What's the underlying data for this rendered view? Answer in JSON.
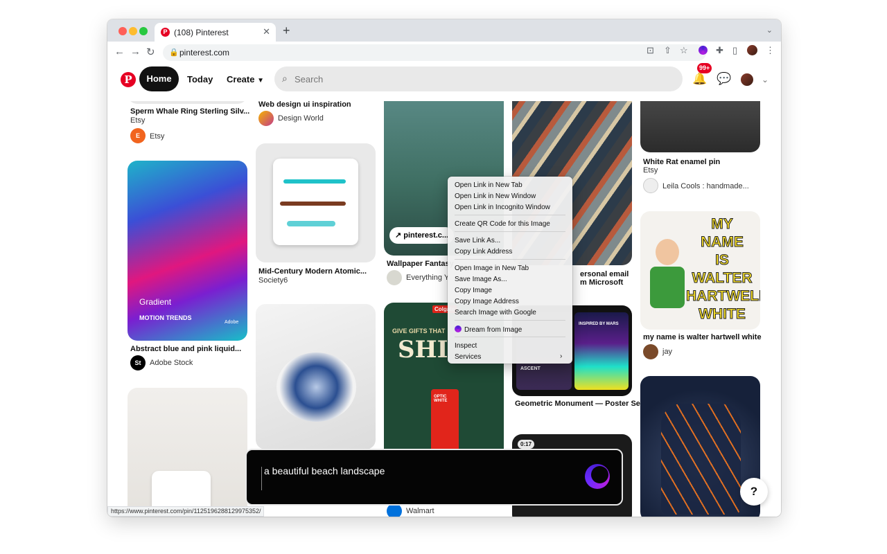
{
  "browser": {
    "tab_title": "(108) Pinterest",
    "tab_favicon": "pinterest-favicon",
    "url": "pinterest.com",
    "status_url": "https://www.pinterest.com/pin/1125196288129975352/"
  },
  "header": {
    "logo_letter": "P",
    "home_label": "Home",
    "today_label": "Today",
    "create_label": "Create",
    "search_placeholder": "Search",
    "notification_badge": "99+"
  },
  "pins": [
    {
      "title": "Sperm Whale Ring Sterling Silv...",
      "subtitle": "Etsy",
      "author": "Etsy",
      "author_initial": "E"
    },
    {
      "title": "Abstract blue and pink liquid...",
      "author": "Adobe Stock",
      "author_initial": "St",
      "image_text_1": "Gradient",
      "image_text_2": "MOTION TRENDS",
      "image_text_3": "Adobe"
    },
    {
      "title": "Web design ui inspiration",
      "author": "Design World"
    },
    {
      "title": "Mid-Century Modern Atomic...",
      "subtitle": "Society6"
    },
    {
      "title": "Wallpaper Fantasy",
      "author": "Everything Y",
      "link_label": "pinterest.c..."
    },
    {
      "title": "Walmart",
      "image_text_1": "Colgate",
      "image_text_2": "GIVE GIFTS THAT",
      "image_text_3": "SHI",
      "image_text_4": "OPTIC WHITE"
    },
    {
      "title_fragment_1": "ersonal email",
      "title_fragment_2": "m Microsoft"
    },
    {
      "title": "Geometric Monument — Poster Series Chpt. I",
      "image_text_1": "INSPIRED BY MARS",
      "image_text_2": "ASCENT"
    },
    {
      "video_time": "0:17"
    },
    {
      "title": "White Rat enamel pin",
      "subtitle": "Etsy",
      "author": "Leila Cools : handmade..."
    },
    {
      "title": "my name is walter hartwell white",
      "author": "jay",
      "image_text": [
        "MY",
        "NAME",
        "IS",
        "WALTER",
        "HARTWELL",
        "WHITE"
      ]
    }
  ],
  "context_menu": {
    "items": [
      "Open Link in New Tab",
      "Open Link in New Window",
      "Open Link in Incognito Window",
      "Create QR Code for this Image",
      "Save Link As...",
      "Copy Link Address",
      "Open Image in New Tab",
      "Save Image As...",
      "Copy Image",
      "Copy Image Address",
      "Search Image with Google",
      "Dream from Image",
      "Inspect",
      "Services"
    ]
  },
  "ai_prompt": {
    "text": "a beautiful beach landscape"
  },
  "help_label": "?",
  "colors": {
    "pinterest_red": "#e60023",
    "ai_bar_background": "#050505",
    "orb_gradient_start": "#4a1fd6",
    "orb_gradient_end": "#b51fe0"
  }
}
